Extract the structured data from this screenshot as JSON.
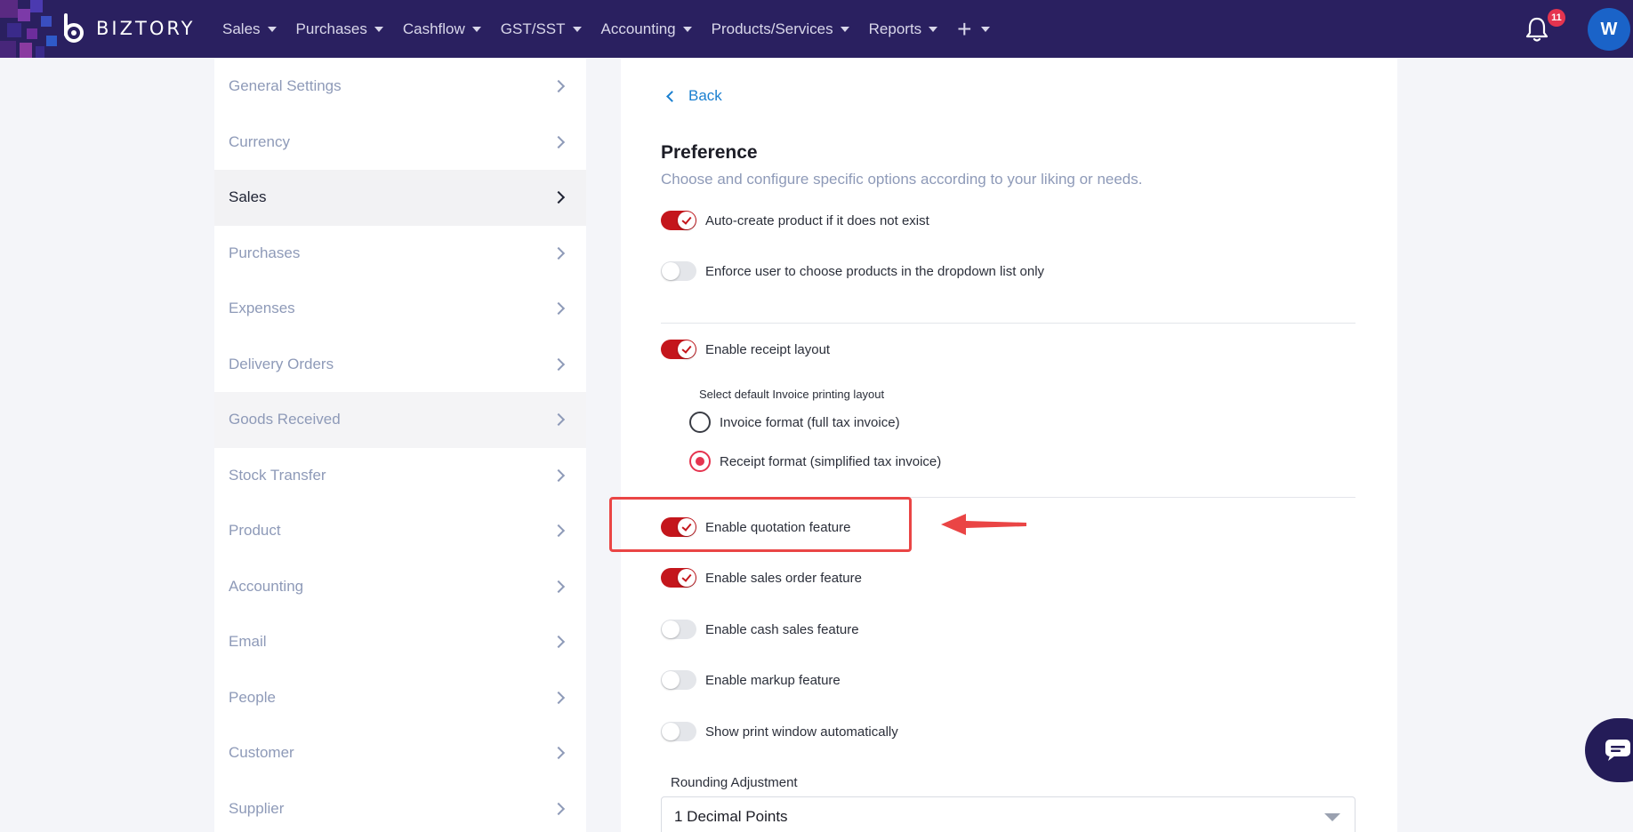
{
  "brand": {
    "name": "BIZTORY"
  },
  "nav": {
    "items": [
      {
        "label": "Sales"
      },
      {
        "label": "Purchases"
      },
      {
        "label": "Cashflow"
      },
      {
        "label": "GST/SST"
      },
      {
        "label": "Accounting"
      },
      {
        "label": "Products/Services"
      },
      {
        "label": "Reports"
      }
    ],
    "plus_label": "+"
  },
  "notifications": {
    "count": "11"
  },
  "user": {
    "initial": "W"
  },
  "sidebar": {
    "items": [
      {
        "label": "General Settings"
      },
      {
        "label": "Currency"
      },
      {
        "label": "Sales",
        "active": true
      },
      {
        "label": "Purchases"
      },
      {
        "label": "Expenses"
      },
      {
        "label": "Delivery Orders"
      },
      {
        "label": "Goods Received"
      },
      {
        "label": "Stock Transfer"
      },
      {
        "label": "Product"
      },
      {
        "label": "Accounting"
      },
      {
        "label": "Email"
      },
      {
        "label": "People"
      },
      {
        "label": "Customer"
      },
      {
        "label": "Supplier"
      }
    ]
  },
  "content": {
    "back_label": "Back",
    "title": "Preference",
    "subtitle": "Choose and configure specific options according to your liking or needs.",
    "toggles": {
      "auto_create": {
        "label": "Auto-create product if it does not exist",
        "on": true
      },
      "enforce_dropdown": {
        "label": "Enforce user to choose products in the dropdown list only",
        "on": false
      },
      "receipt_layout": {
        "label": "Enable receipt layout",
        "on": true
      },
      "quotation": {
        "label": "Enable quotation feature",
        "on": true
      },
      "sales_order": {
        "label": "Enable sales order feature",
        "on": true
      },
      "cash_sales": {
        "label": "Enable cash sales feature",
        "on": false
      },
      "markup": {
        "label": "Enable markup feature",
        "on": false
      },
      "print_window": {
        "label": "Show print window automatically",
        "on": false
      }
    },
    "layout_select_label": "Select default Invoice printing layout",
    "radio_options": [
      {
        "label": "Invoice format (full tax invoice)",
        "checked": false
      },
      {
        "label": "Receipt format (simplified tax invoice)",
        "checked": true
      }
    ],
    "rounding": {
      "label": "Rounding Adjustment",
      "value": "1 Decimal Points"
    }
  },
  "colors": {
    "nav_bg": "#2a2060",
    "toggle_on": "#c4161c",
    "link": "#1a7fd0",
    "highlight": "#ea4545"
  }
}
